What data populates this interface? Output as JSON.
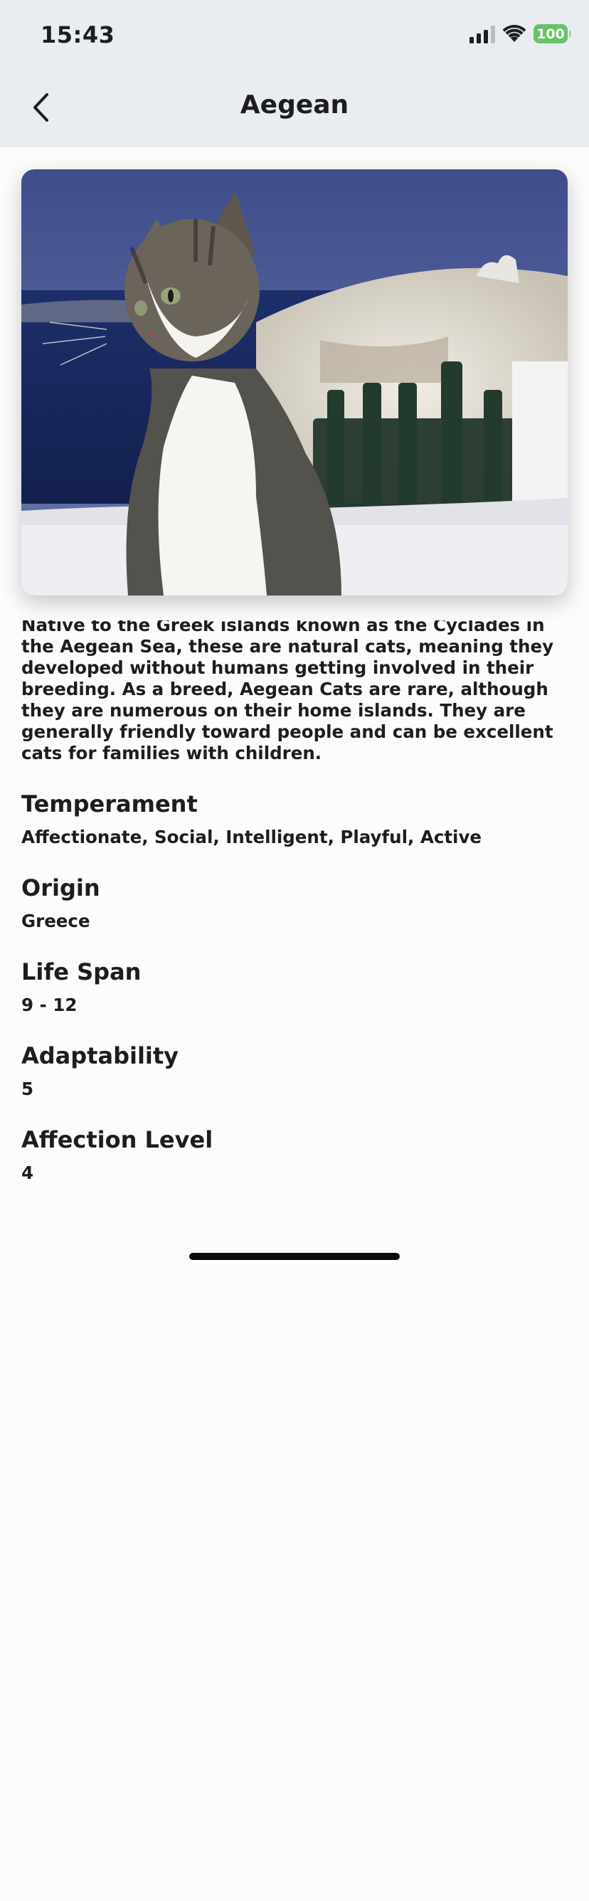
{
  "status_bar": {
    "time": "15:43",
    "battery_level": "100",
    "icons": [
      "cellular-signal-icon",
      "wifi-icon",
      "battery-icon"
    ]
  },
  "nav": {
    "title": "Aegean",
    "back_icon": "chevron-left-icon"
  },
  "breed": {
    "description": "Native to the Greek islands known as the Cyclades in the Aegean Sea, these are natural cats, meaning they developed without humans getting involved in their breeding. As a breed, Aegean Cats are rare, although they are numerous on their home islands. They are generally friendly toward people and can be excellent cats for families with children.",
    "attributes": [
      {
        "label": "Temperament",
        "value": "Affectionate, Social, Intelligent, Playful, Active"
      },
      {
        "label": "Origin",
        "value": "Greece"
      },
      {
        "label": "Life Span",
        "value": "9 - 12"
      },
      {
        "label": "Adaptability",
        "value": "5"
      },
      {
        "label": "Affection Level",
        "value": "4"
      }
    ]
  },
  "colors": {
    "header_bg": "#e9edf2",
    "battery": "#65c466",
    "text": "#1d1d1f"
  }
}
